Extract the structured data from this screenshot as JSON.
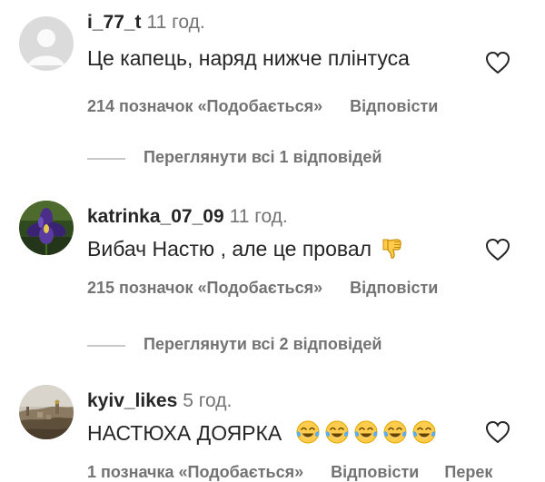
{
  "comments": [
    {
      "username": "i_77_t",
      "time": "11 год.",
      "text": "Це капець, наряд нижче плінтуса",
      "likes": "214 позначок «Подобається»",
      "reply": "Відповісти",
      "avatar": "default-avatar-icon"
    },
    {
      "username": "katrinka_07_09",
      "time": "11 год.",
      "text": "Вибач Настю , але це провал",
      "likes": "215 позначок «Подобається»",
      "reply": "Відповісти",
      "emoji": "thumbs-down-emoji",
      "avatar": "iris-flower-photo"
    },
    {
      "username": "kyiv_likes",
      "time": "5 год.",
      "text": "НАСТЮХА ДОЯРКА",
      "likes": "1 позначка «Подобається»",
      "reply": "Відповісти",
      "extra": "Перек",
      "emoji": "tears-of-joy-emoji",
      "emoji_count": 5,
      "avatar": "city-panorama-photo"
    }
  ],
  "view_replies": [
    {
      "label": "Переглянути всі 1 відповідей"
    },
    {
      "label": "Переглянути всі 2 відповідей"
    }
  ],
  "colors": {
    "primary_text": "#262626",
    "secondary_text": "#737373",
    "divider": "#c7c7c7",
    "background": "#ffffff"
  }
}
